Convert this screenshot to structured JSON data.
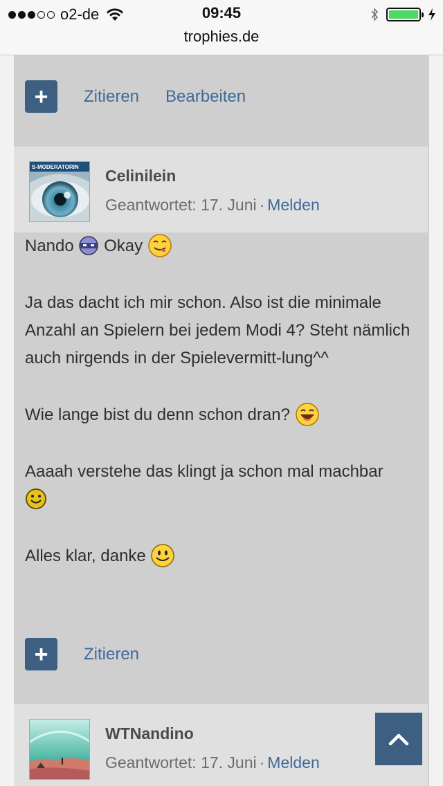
{
  "status_bar": {
    "carrier": "o2-de",
    "time": "09:45",
    "url": "trophies.de",
    "battery_level": 1.0
  },
  "first_post_actions": {
    "add_label": "+",
    "quote_label": "Zitieren",
    "edit_label": "Bearbeiten"
  },
  "post": {
    "avatar_badge": "S-MODERATORIN",
    "username": "Celinilein",
    "answered_label": "Geantwortet: 17. Juni",
    "separator": "·",
    "report_label": "Melden",
    "paragraphs": {
      "p1a": "Nando",
      "p1b": "Okay",
      "p2": "Ja das dacht ich mir schon. Also ist die minimale Anzahl an Spielern bei jedem Modi 4? Steht nämlich auch nirgends in der Spielevermitt-lung^^",
      "p3": "Wie lange bist du denn schon dran?",
      "p4": "Aaaah verstehe das klingt ja schon mal machbar",
      "p5": "Alles klar, danke"
    },
    "icons": [
      "ninja-smiley-icon",
      "tongue-smiley-icon",
      "grin-smiley-icon",
      "small-smile-icon",
      "smile-icon"
    ]
  },
  "post_actions": {
    "add_label": "+",
    "quote_label": "Zitieren"
  },
  "next_post": {
    "username": "WTNandino",
    "answered_label": "Geantwortet: 17. Juni",
    "separator": "·",
    "report_label": "Melden"
  },
  "scroll_top_icon": "chevron-up-icon"
}
